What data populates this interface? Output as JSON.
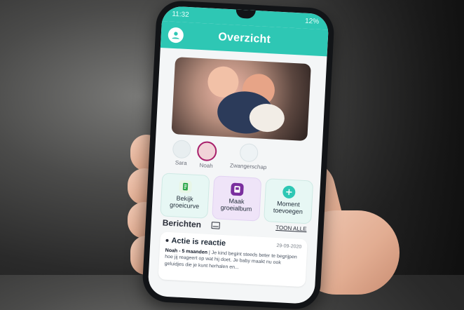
{
  "status": {
    "time": "11:32",
    "right": "12%"
  },
  "header": {
    "title": "Overzicht"
  },
  "kids": [
    {
      "name": "Sara"
    },
    {
      "name": "Noah"
    },
    {
      "name": "Zwangerschap"
    }
  ],
  "actions": [
    {
      "label": "Bekijk groeicurve",
      "icon": "growth-curve-icon"
    },
    {
      "label": "Maak groeialbum",
      "icon": "album-icon"
    },
    {
      "label": "Moment toevoegen",
      "icon": "plus-icon"
    }
  ],
  "messages": {
    "title": "Berichten",
    "link": "TOON ALLE",
    "item": {
      "title": "Actie is reactie",
      "date": "29-09-2020",
      "meta": "Noah - 5 maanden",
      "text": "| Je kind begint steeds beter te begrijpen hoe jij reageert op wat hij doet. Je baby maakt nu ook geluidjes die je kunt herhalen en..."
    }
  },
  "colors": {
    "brand": "#2ec7b4",
    "accent": "#a81f6b",
    "album": "#7a2e9e"
  }
}
